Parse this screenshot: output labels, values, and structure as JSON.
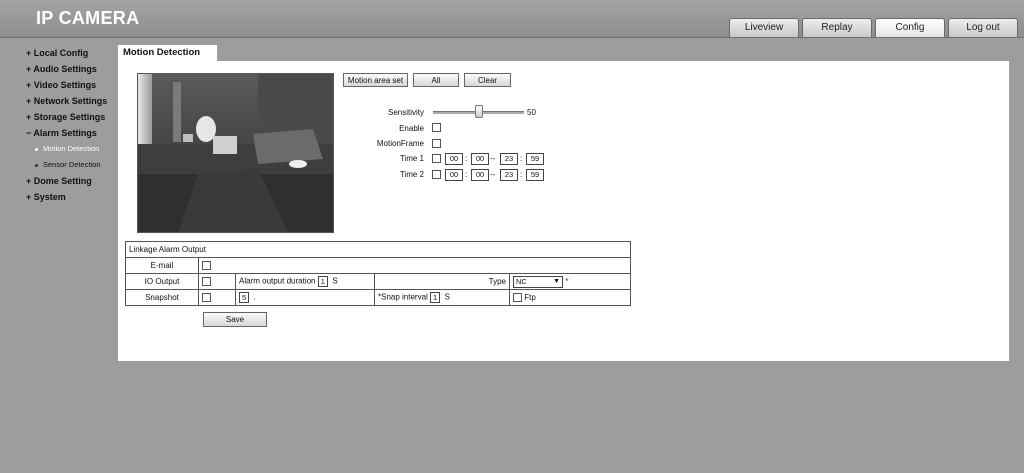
{
  "header": {
    "title": "IP CAMERA"
  },
  "tabs": [
    "Liveview",
    "Replay",
    "Config",
    "Log out"
  ],
  "sidebar": {
    "local_config": "+ Local Config",
    "audio_settings": "+ Audio Settings",
    "video_settings": "+ Video Settings",
    "network_settings": "+ Network Settings",
    "storage_settings": "+ Storage Settings",
    "alarm_settings": "− Alarm Settings",
    "motion_detection": "Motion Detection",
    "sensor_detection": "Sensor Detection",
    "dome_setting": "+ Dome Setting",
    "system": "+ System"
  },
  "panel": {
    "tab_title": "Motion Detection",
    "buttons": {
      "motion_area_set": "Motion area set",
      "all": "All",
      "clear": "Clear",
      "save": "Save"
    },
    "sensitivity_label": "Sensitivity",
    "sensitivity_value": "50",
    "enable_label": "Enable",
    "motionframe_label": "MotionFrame",
    "time1": {
      "label": "Time 1",
      "h1": "00",
      "m1": "00",
      "h2": "23",
      "m2": "59"
    },
    "time2": {
      "label": "Time 2",
      "h1": "00",
      "m1": "00",
      "h2": "23",
      "m2": "59"
    },
    "time_sep": ":",
    "range_sep": "--"
  },
  "linkage": {
    "header": "Linkage Alarm Output",
    "email_label": "E-mail",
    "io_output_label": "IO Output",
    "alarm_duration_label": "Alarm output duration",
    "alarm_duration_value": "1",
    "seconds_unit": "S",
    "type_label": "Type",
    "type_value": "NC",
    "required_mark": "*",
    "snapshot_label": "Snapshot",
    "snapshot_count": "5",
    "snapshot_dot": ".",
    "snap_interval_label": "*Snap interval",
    "snap_interval_value": "1",
    "ftp_label": "Ftp"
  }
}
